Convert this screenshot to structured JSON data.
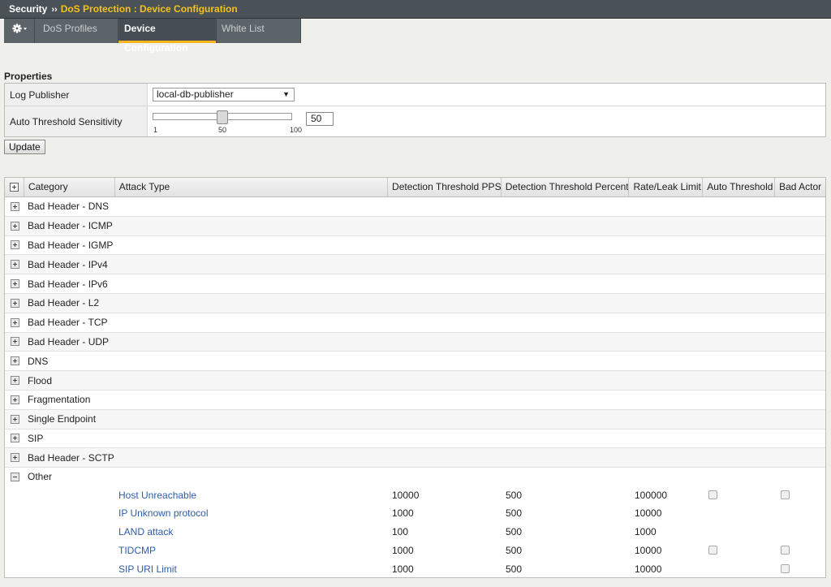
{
  "breadcrumb": {
    "root": "Security",
    "separator": "››",
    "path": "DoS Protection : Device Configuration"
  },
  "tabs": {
    "dos_profiles": "DoS Profiles",
    "device_configuration": "Device Configuration",
    "white_list": "White List"
  },
  "properties": {
    "title": "Properties",
    "log_publisher_label": "Log Publisher",
    "log_publisher_value": "local-db-publisher",
    "sensitivity_label": "Auto Threshold Sensitivity",
    "sensitivity_value": "50",
    "slider_min": "1",
    "slider_mid": "50",
    "slider_max": "100",
    "slider_level_pct": 50
  },
  "update_button": "Update",
  "table": {
    "columns": [
      "Category",
      "Attack Type",
      "Detection Threshold PPS",
      "Detection Threshold Percent",
      "Rate/Leak Limit",
      "Auto Threshold",
      "Bad Actor"
    ],
    "categories": [
      "Bad Header - DNS",
      "Bad Header - ICMP",
      "Bad Header - IGMP",
      "Bad Header - IPv4",
      "Bad Header - IPv6",
      "Bad Header - L2",
      "Bad Header - TCP",
      "Bad Header - UDP",
      "DNS",
      "Flood",
      "Fragmentation",
      "Single Endpoint",
      "SIP",
      "Bad Header - SCTP"
    ],
    "expanded_category": "Other",
    "rows": [
      {
        "name": "Host Unreachable",
        "pps": "10000",
        "percent": "500",
        "rate": "100000",
        "auto": true,
        "bad": true
      },
      {
        "name": "IP Unknown protocol",
        "pps": "1000",
        "percent": "500",
        "rate": "10000",
        "auto": false,
        "bad": false
      },
      {
        "name": "LAND attack",
        "pps": "100",
        "percent": "500",
        "rate": "1000",
        "auto": false,
        "bad": false
      },
      {
        "name": "TIDCMP",
        "pps": "1000",
        "percent": "500",
        "rate": "10000",
        "auto": true,
        "bad": true
      },
      {
        "name": "SIP URI Limit",
        "pps": "1000",
        "percent": "500",
        "rate": "10000",
        "auto": false,
        "bad": true
      }
    ]
  },
  "colors": {
    "titlebar": "#4a5258",
    "breadcrumb_accent": "#f4c21b",
    "active_tab_underline": "#f4b51b",
    "link": "#2f5da8"
  }
}
